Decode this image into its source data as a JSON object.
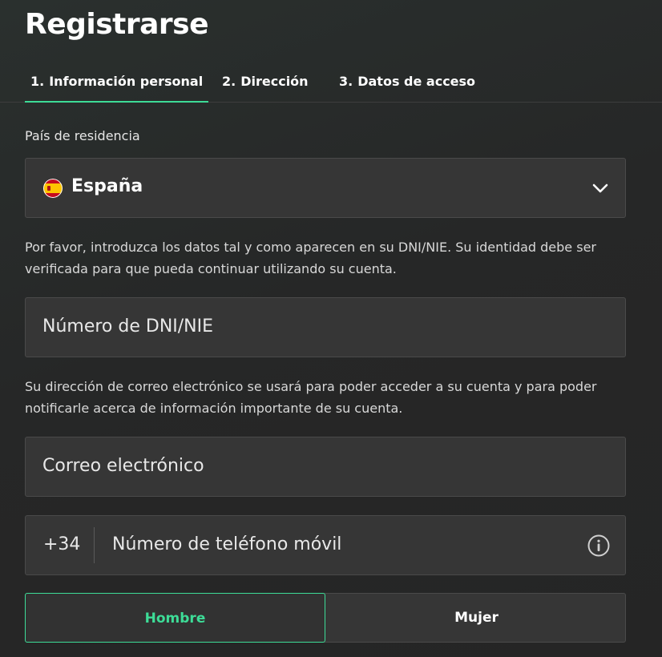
{
  "header": {
    "title": "Registrarse"
  },
  "tabs": [
    {
      "num": "1.",
      "label": "Información personal",
      "active": true
    },
    {
      "num": "2.",
      "label": "Dirección",
      "active": false
    },
    {
      "num": "3.",
      "label": "Datos de acceso",
      "active": false
    }
  ],
  "country": {
    "label": "País de residencia",
    "value": "España",
    "flag_icon": "spain-flag-icon"
  },
  "dni": {
    "note": "Por favor, introduzca los datos tal y como aparecen en su DNI/NIE. Su identidad debe ser verificada para que pueda continuar utilizando su cuenta.",
    "placeholder": "Número de DNI/NIE"
  },
  "email": {
    "note": "Su dirección de correo electrónico se usará para poder acceder a su cuenta y para poder notificarle acerca de información importante de su cuenta.",
    "placeholder": "Correo electrónico"
  },
  "phone": {
    "prefix": "+34",
    "placeholder": "Número de teléfono móvil",
    "info_icon": "info-icon"
  },
  "gender": {
    "options": [
      "Hombre",
      "Mujer"
    ],
    "selected": "Hombre"
  },
  "colors": {
    "accent": "#3ddc97",
    "field_bg": "#363636",
    "page_bg": "#262626"
  }
}
